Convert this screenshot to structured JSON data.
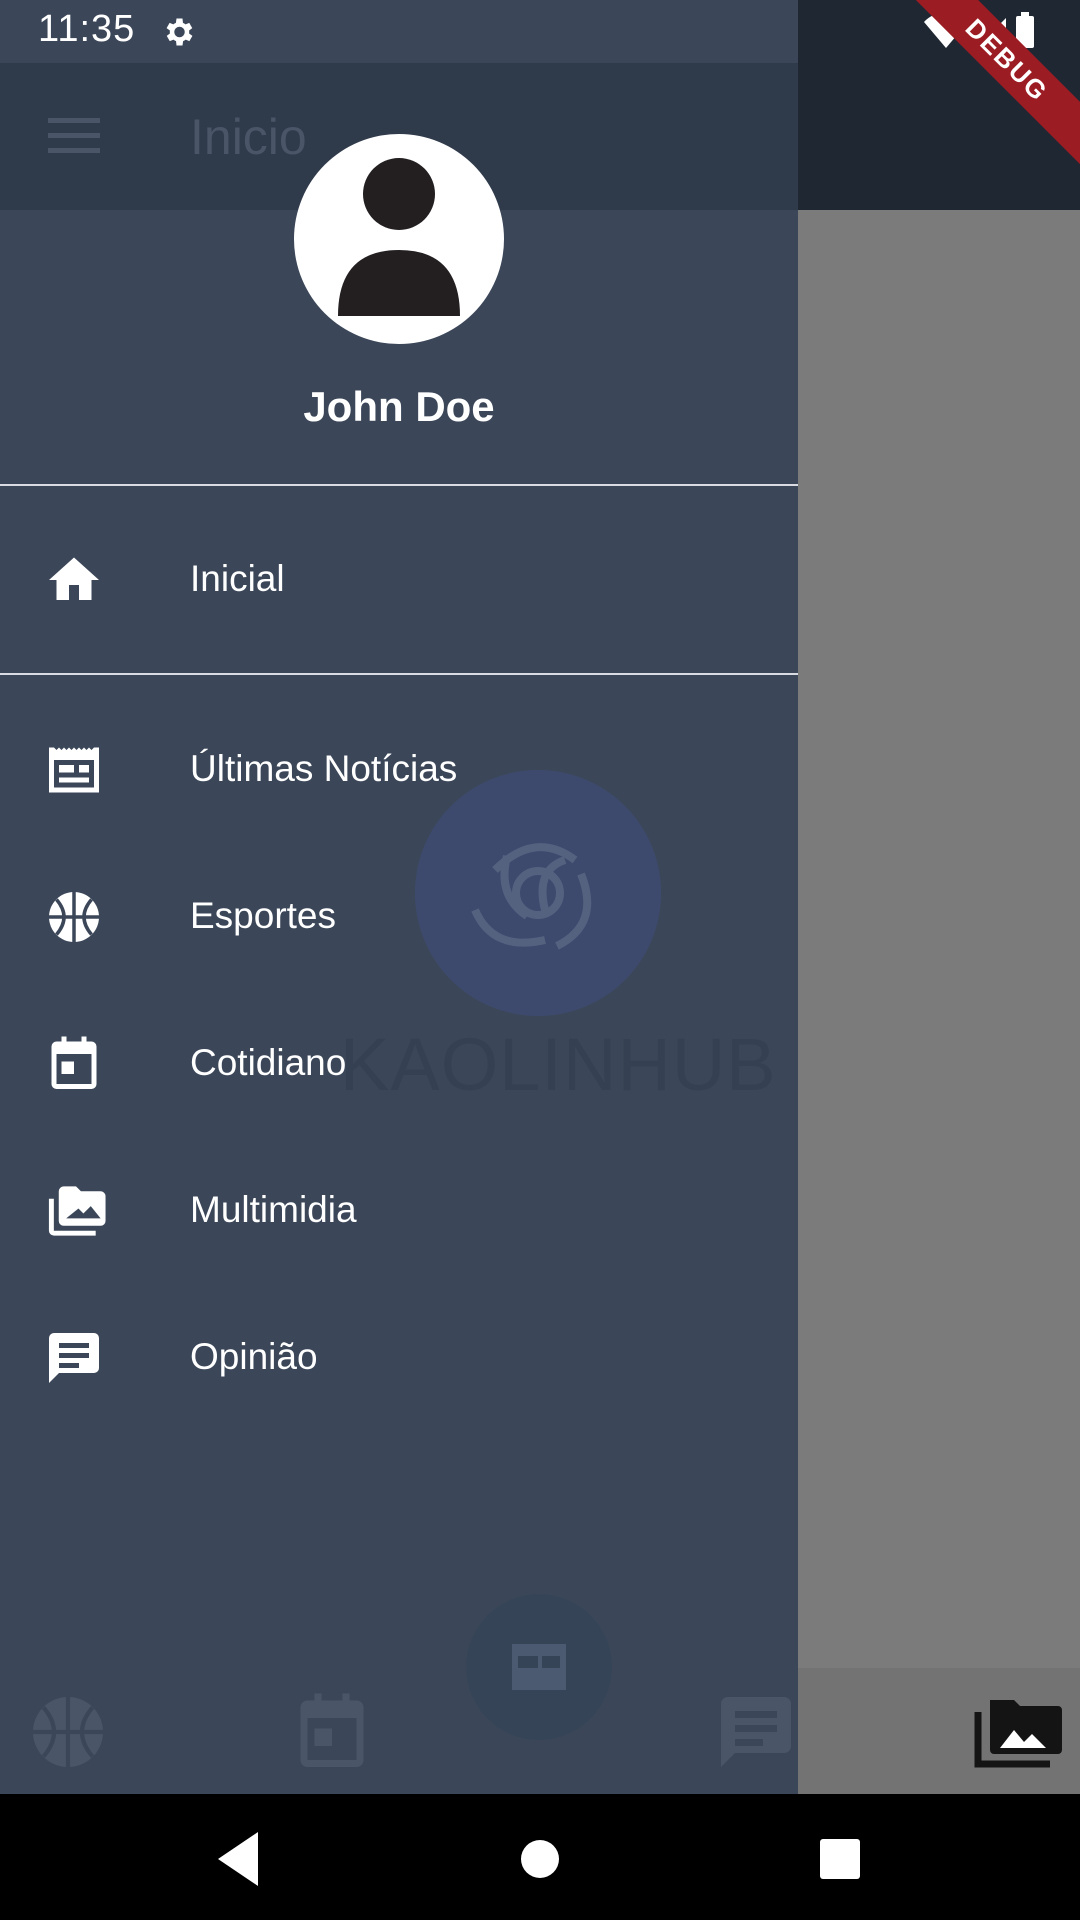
{
  "status_bar": {
    "time": "11:35",
    "settings_icon": "gear-icon",
    "wifi_icon": "wifi-icon",
    "signal_icon": "signal-icon",
    "battery_icon": "battery-icon"
  },
  "debug_banner": "DEBUG",
  "app_bar": {
    "menu_icon": "menu-icon",
    "title": "Inicio"
  },
  "drawer": {
    "user": {
      "name": "John Doe",
      "avatar_icon": "person-icon"
    },
    "items": [
      {
        "label": "Inicial",
        "icon": "home-icon"
      },
      {
        "label": "Últimas Notícias",
        "icon": "newspaper-icon"
      },
      {
        "label": "Esportes",
        "icon": "basketball-icon"
      },
      {
        "label": "Cotidiano",
        "icon": "calendar-icon"
      },
      {
        "label": "Multimidia",
        "icon": "photo-library-icon"
      },
      {
        "label": "Opinião",
        "icon": "chat-icon"
      }
    ],
    "watermark": "KAOLINHUB"
  },
  "bottom_nav": {
    "items": [
      "basketball-icon",
      "calendar-icon",
      "newspaper-icon",
      "chat-icon",
      "photo-library-icon"
    ]
  },
  "system_nav": {
    "back": "back-icon",
    "home": "home-circle-icon",
    "recents": "recents-icon"
  }
}
